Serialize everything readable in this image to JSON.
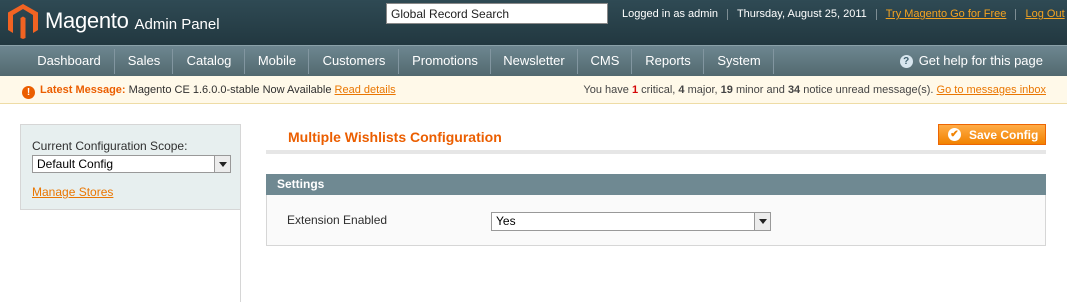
{
  "header": {
    "brand": "Magento",
    "brand_sub": "Admin Panel",
    "search_value": "Global Record Search",
    "logged_in": "Logged in as admin",
    "date": "Thursday, August 25, 2011",
    "try_link": "Try Magento Go for Free",
    "logout_link": "Log Out"
  },
  "nav": {
    "items": [
      "Dashboard",
      "Sales",
      "Catalog",
      "Mobile",
      "Customers",
      "Promotions",
      "Newsletter",
      "CMS",
      "Reports",
      "System"
    ],
    "help": "Get help for this page",
    "help_icon": "question-icon"
  },
  "message": {
    "title": "Latest Message:",
    "text": "Magento CE 1.6.0.0-stable Now Available",
    "read_details": "Read details",
    "count_prefix": "You have",
    "critical_count": "1",
    "critical_label": "critical,",
    "major_count": "4",
    "major_label": "major,",
    "minor_count": "19",
    "minor_label": "minor and",
    "notice_count": "34",
    "notice_label": "notice unread message(s).",
    "inbox_link": "Go to messages inbox"
  },
  "sidebar": {
    "scope_label": "Current Configuration Scope:",
    "scope_value": "Default Config",
    "manage_stores": "Manage Stores"
  },
  "main": {
    "title": "Multiple Wishlists Configuration",
    "save_label": "Save Config",
    "section_title": "Settings",
    "field_label": "Extension Enabled",
    "field_value": "Yes"
  },
  "colors": {
    "accent": "#eb5e00",
    "header_bg": "#2a434c",
    "nav_bg": "#627b84",
    "section_head": "#6f8992"
  }
}
